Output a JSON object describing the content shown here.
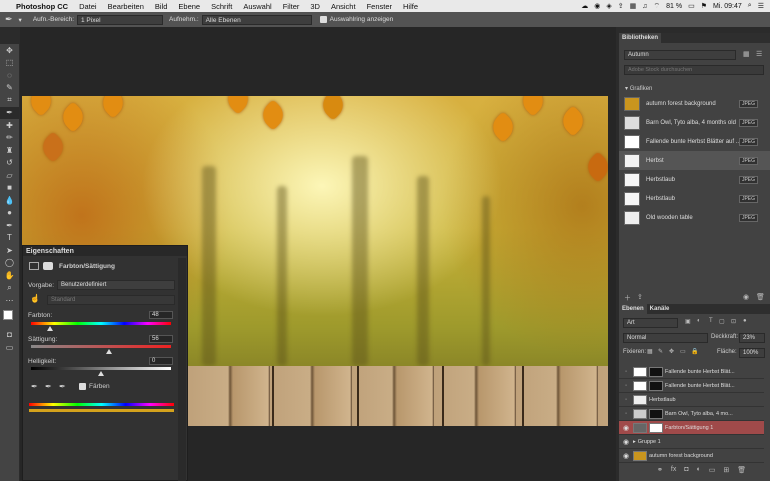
{
  "menubar": {
    "app": "Photoshop CC",
    "items": [
      "Datei",
      "Bearbeiten",
      "Bild",
      "Ebene",
      "Schrift",
      "Auswahl",
      "Filter",
      "3D",
      "Ansicht",
      "Fenster",
      "Hilfe"
    ],
    "battery": "81 %",
    "clock": "Mi. 09:47"
  },
  "options": {
    "sample_label": "Aufn.-Bereich:",
    "sample_value": "1 Pixel",
    "aufn_label": "Aufnehm.:",
    "aufn_value": "Alle Ebenen",
    "ring_label": "Auswahlring anzeigen"
  },
  "properties": {
    "tab": "Eigenschaften",
    "adjustment": "Farbton/Sättigung",
    "preset_label": "Vorgabe:",
    "preset_value": "Benutzerdefiniert",
    "channel_value": "Standard",
    "hue_label": "Farbton:",
    "hue_value": "48",
    "sat_label": "Sättigung:",
    "sat_value": "56",
    "light_label": "Helligkeit:",
    "light_value": "0",
    "colorize_label": "Färben"
  },
  "libraries": {
    "tab": "Bibliotheken",
    "library_name": "Autumn",
    "search_placeholder": "Adobe Stock durchsuchen",
    "group": "Grafiken",
    "items": [
      {
        "name": "autumn forest background",
        "badge": "JPEG"
      },
      {
        "name": "Barn Owl, Tyto alba, 4 months old",
        "badge": "JPEG"
      },
      {
        "name": "Fallende bunte Herbst Blätter auf ...",
        "badge": "JPEG"
      },
      {
        "name": "Herbst",
        "badge": "JPEG"
      },
      {
        "name": "Herbstlaub",
        "badge": "JPEG"
      },
      {
        "name": "Herbstlaub",
        "badge": "JPEG"
      },
      {
        "name": "Old wooden table",
        "badge": "JPEG"
      }
    ]
  },
  "layers": {
    "tabs": [
      "Ebenen",
      "Kanäle"
    ],
    "filter": "Art",
    "blend": "Normal",
    "opacity_label": "Deckkraft:",
    "opacity": "23%",
    "lock_label": "Fixieren:",
    "fill_label": "Fläche:",
    "fill": "100%",
    "items": [
      {
        "name": "Fallende bunte Herbst Blät..."
      },
      {
        "name": "Fallende bunte Herbst Blät..."
      },
      {
        "name": "Herbstlaub"
      },
      {
        "name": "Barn Owl, Tyto alba, 4 mo..."
      },
      {
        "name": "Farbton/Sättigung 1"
      },
      {
        "name": "Gruppe 1"
      },
      {
        "name": "autumn forest background"
      }
    ]
  },
  "colors": {
    "accent_selected": "#a04a4a",
    "panel": "#424242"
  }
}
